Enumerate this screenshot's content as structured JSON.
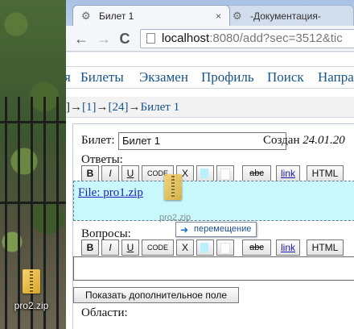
{
  "desktop": {
    "icon_label": "pro2.zip"
  },
  "browser": {
    "tabs": [
      {
        "title": "Билет 1",
        "active": true,
        "close": "×"
      },
      {
        "title": "-Документация-",
        "active": false,
        "close": "×"
      }
    ],
    "toolbar": {
      "back": "←",
      "forward": "→",
      "reload": "C"
    },
    "url": {
      "host": "localhost",
      "rest": ":8080/add?sec=3512&tic"
    }
  },
  "menu": [
    "я",
    "Билеты",
    "Экзамен",
    "Профиль",
    "Поиск",
    "Напра"
  ],
  "breadcrumb": {
    "pre": "]",
    "sep": "→",
    "items": [
      "[1]",
      "[24]",
      "Билет 1"
    ]
  },
  "form": {
    "ticket_label": "Билет:",
    "ticket_value": "Билет 1",
    "created_label": "Создан",
    "created_value": "24.01.20",
    "answers_label": "Ответы:",
    "questions_label": "Вопросы:",
    "areas_label": "Области:",
    "more_field_button": "Показать дополнительное поле",
    "attached_file": "File: pro1.zip"
  },
  "format_buttons": [
    "B",
    "I",
    "U",
    "CODE",
    "X",
    "",
    "",
    "abc",
    "link",
    "HTML"
  ],
  "drag": {
    "ghost_label": "pro2.zip",
    "tooltip": "перемещение"
  }
}
